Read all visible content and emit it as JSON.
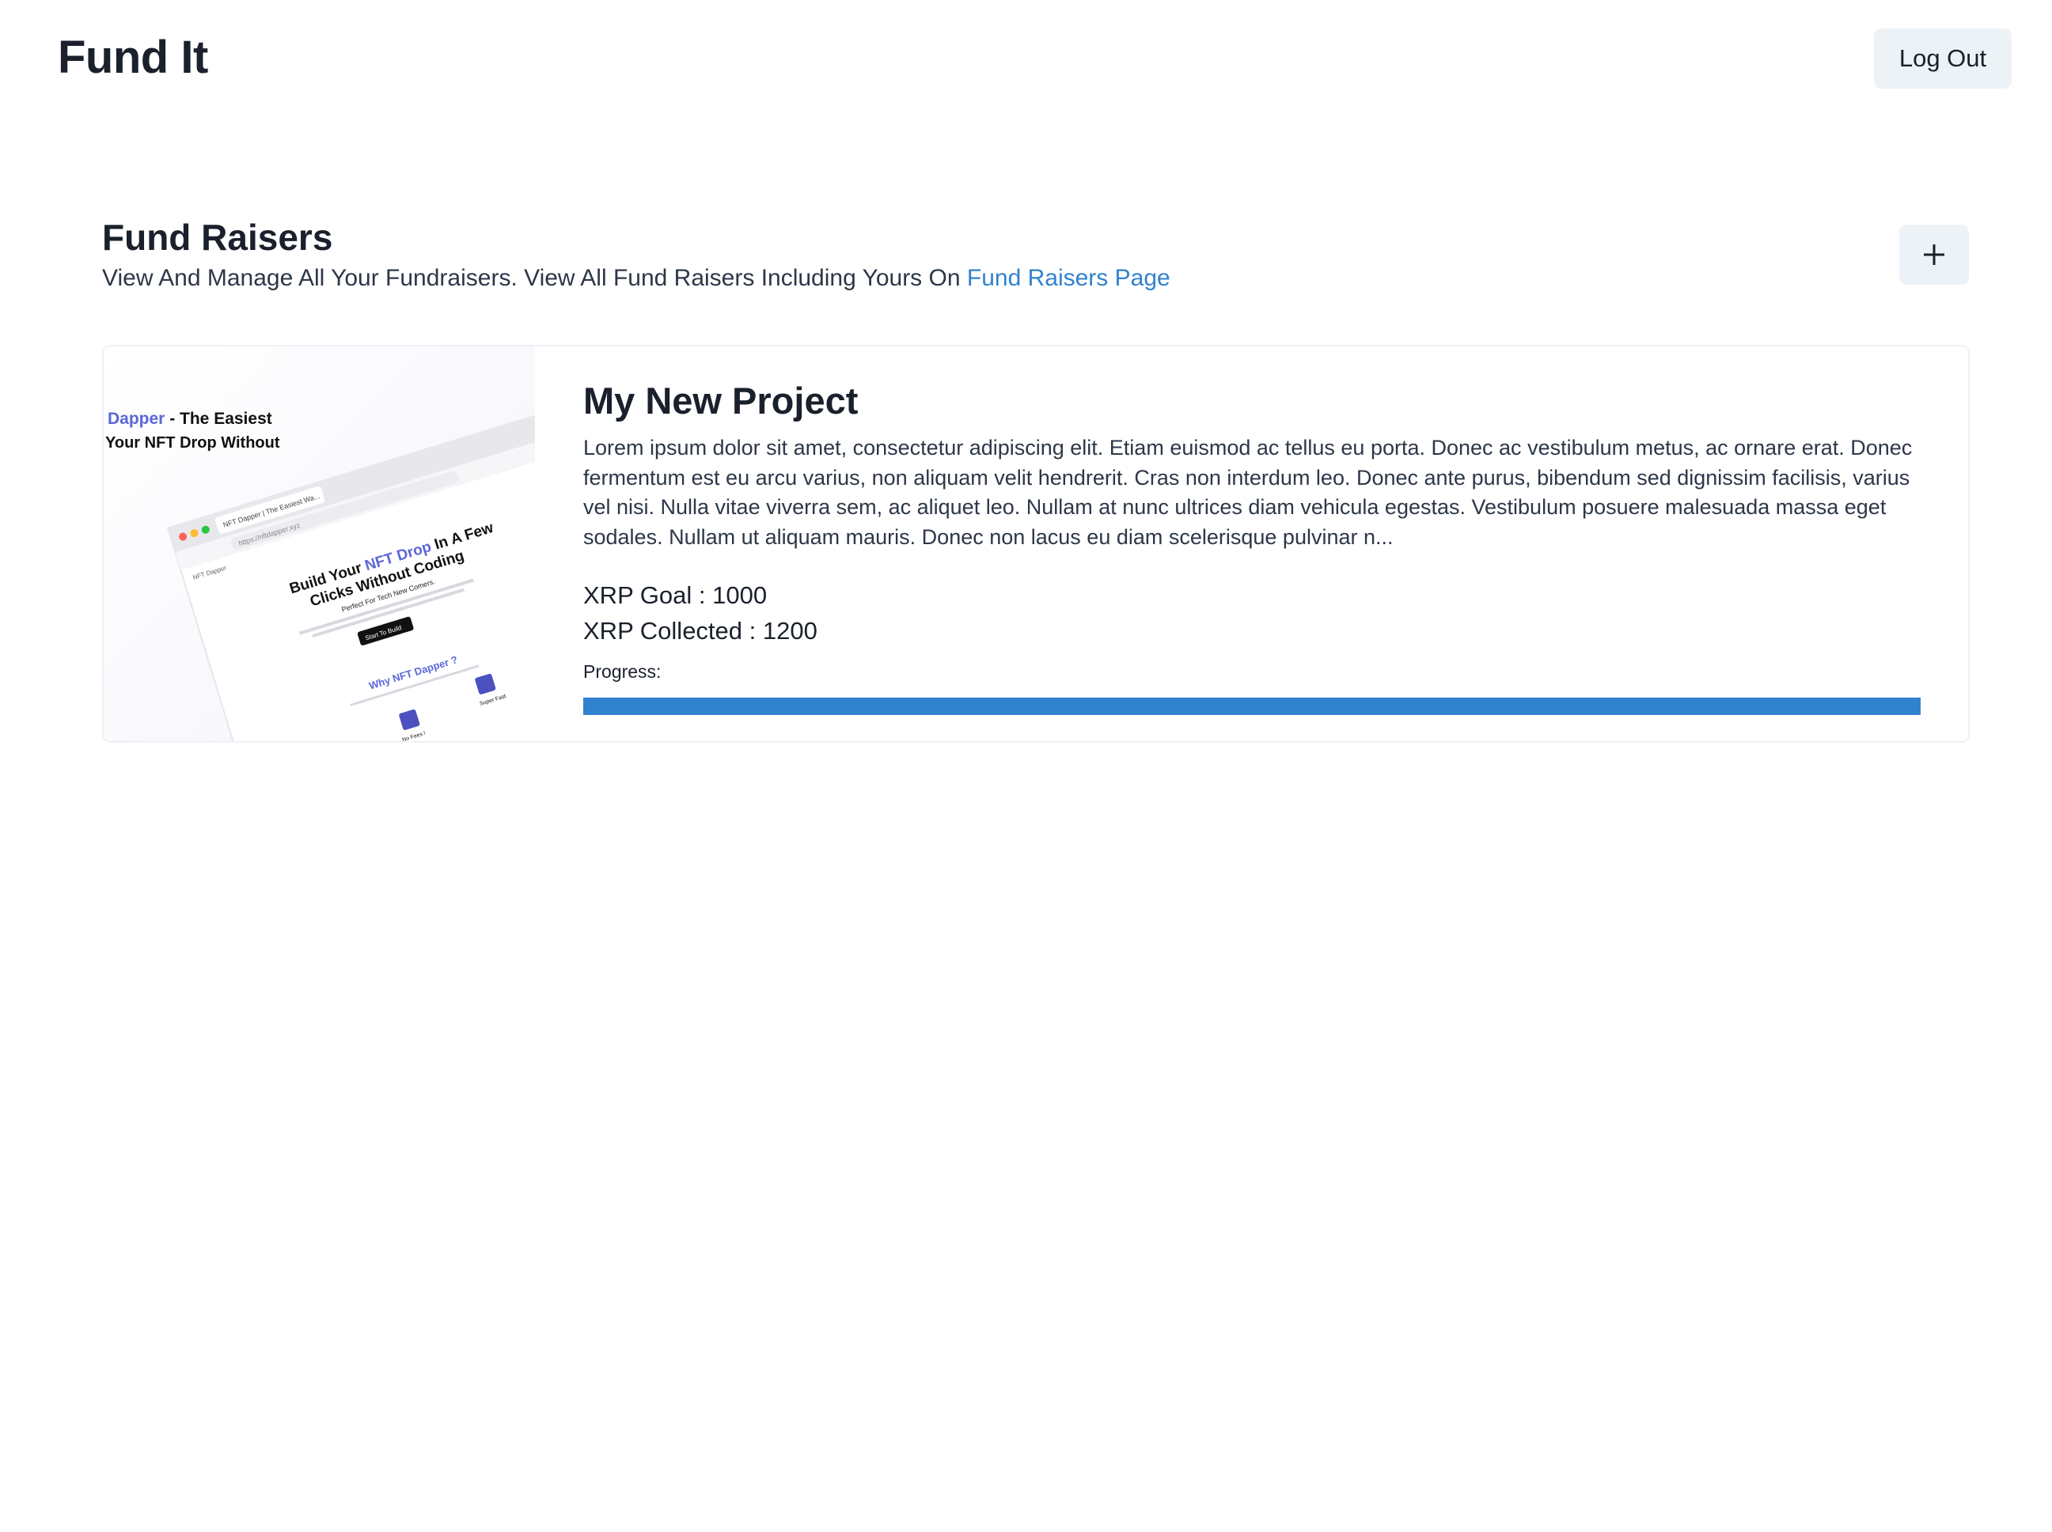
{
  "app": {
    "brand": "Fund It",
    "logout_label": "Log Out"
  },
  "section": {
    "title": "Fund Raisers",
    "subtitle": "View And Manage All Your Fundraisers. View All Fund Raisers Including Yours On ",
    "link_text": "Fund Raisers Page",
    "add_icon": "plus-icon"
  },
  "fundraisers": [
    {
      "title": "My New Project",
      "description": "Lorem ipsum dolor sit amet, consectetur adipiscing elit. Etiam euismod ac tellus eu porta. Donec ac vestibulum metus, ac ornare erat. Donec fermentum est eu arcu varius, non aliquam velit hendrerit. Cras non interdum leo. Donec ante purus, bibendum sed dignissim facilisis, varius vel nisi. Nulla vitae viverra sem, ac aliquet leo. Nullam at nunc ultrices diam vehicula egestas. Vestibulum posuere malesuada massa eget sodales. Nullam ut aliquam mauris. Donec non lacus eu diam scelerisque pulvinar n...",
      "goal_text": "XRP Goal : 1000",
      "collected_text": "XRP Collected : 1200",
      "progress_label": "Progress:",
      "progress_fraction": 1.0,
      "thumbnail": {
        "headline_brand": "Dapper",
        "headline_rest": " - The Easiest",
        "headline_line2": "Your NFT Drop Without",
        "tab_label": "NFT Dapper | The Easiest Wa...",
        "url": "https://nftdapper.xyz",
        "bookmark": "NFT Dapper",
        "hero_line1_a": "Build Your ",
        "hero_line1_b": "NFT Drop",
        "hero_line1_c": " In A Few",
        "hero_line2": "Clicks Without Coding",
        "hero_sub": "Perfect For Tech New Comers.",
        "cta": "Start To Build",
        "why_a": "Why ",
        "why_b": "NFT Dapper ?",
        "feature_1": "No Fees !",
        "feature_2": "Super Fast"
      }
    }
  ],
  "colors": {
    "accent": "#3182ce",
    "button_bg": "#edf2f7",
    "text": "#1a202c",
    "dapper_purple": "#5a67d8"
  }
}
